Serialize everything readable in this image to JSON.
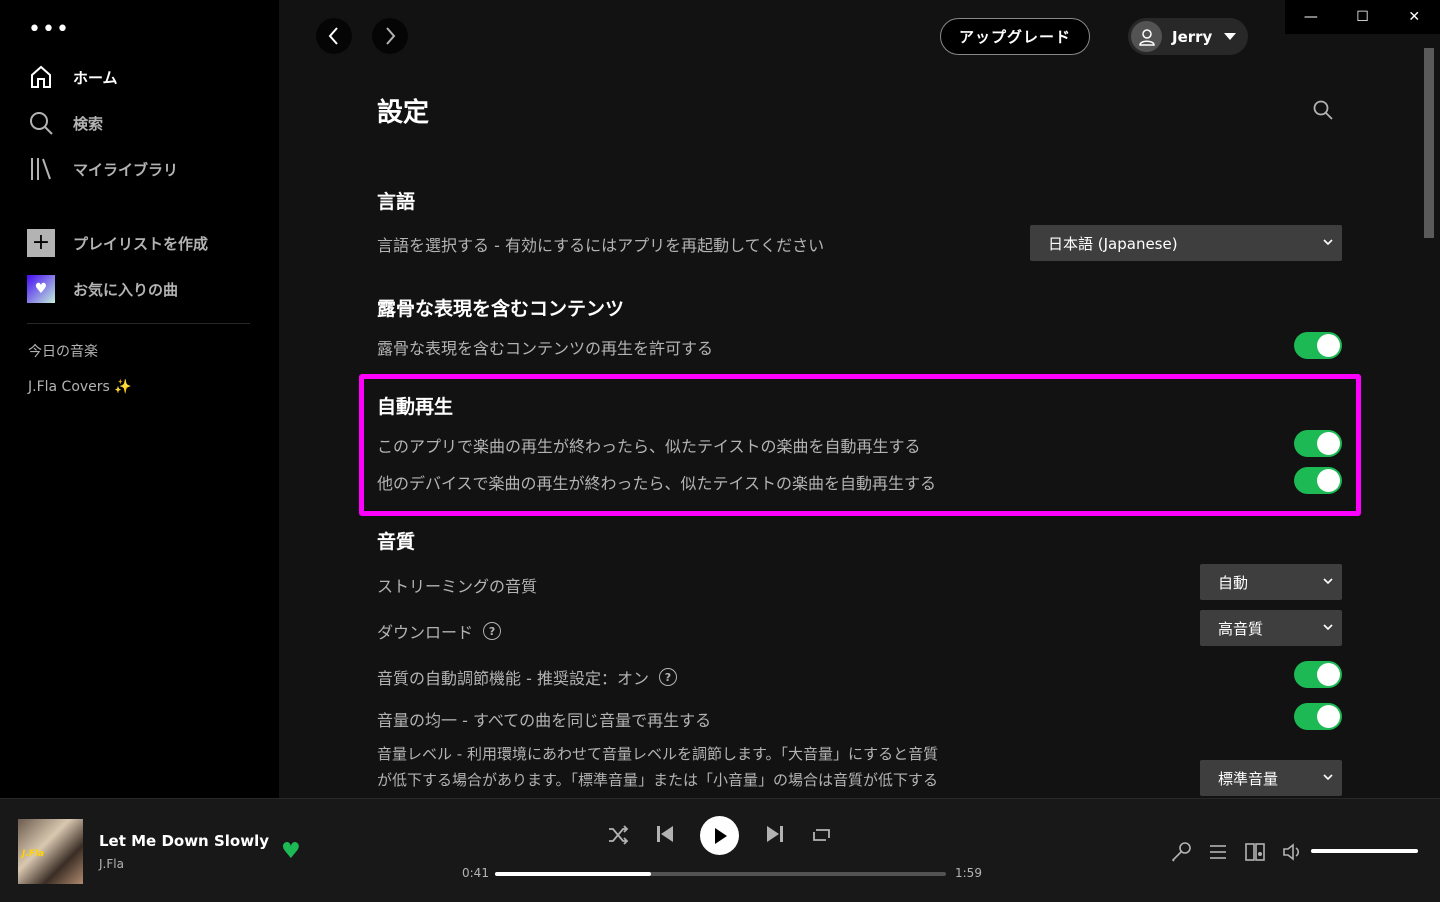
{
  "sidebar": {
    "menu_dots": "•••",
    "nav": [
      {
        "label": "ホーム",
        "icon": "home-icon"
      },
      {
        "label": "検索",
        "icon": "search-icon"
      },
      {
        "label": "マイライブラリ",
        "icon": "library-icon"
      }
    ],
    "actions": [
      {
        "label": "プレイリストを作成",
        "icon": "plus-icon"
      },
      {
        "label": "お気に入りの曲",
        "icon": "heart-icon"
      }
    ],
    "playlists": [
      "今日の音楽",
      "J.Fla Covers ✨"
    ]
  },
  "header": {
    "upgrade_label": "アップグレード",
    "user_name": "Jerry"
  },
  "settings": {
    "title": "設定",
    "language": {
      "heading": "言語",
      "label": "言語を選択する - 有効にするにはアプリを再起動してください",
      "value": "日本語 (Japanese)"
    },
    "explicit": {
      "heading": "露骨な表現を含むコンテンツ",
      "label": "露骨な表現を含むコンテンツの再生を許可する",
      "on": true
    },
    "autoplay": {
      "heading": "自動再生",
      "label1": "このアプリで楽曲の再生が終わったら、似たテイストの楽曲を自動再生する",
      "label2": "他のデバイスで楽曲の再生が終わったら、似たテイストの楽曲を自動再生する",
      "on1": true,
      "on2": true
    },
    "quality": {
      "heading": "音質",
      "streaming_label": "ストリーミングの音質",
      "streaming_value": "自動",
      "download_label": "ダウンロード",
      "download_value": "高音質",
      "auto_adjust_label": "音質の自動調節機能 - 推奨設定：オン",
      "normalize_label": "音量の均一 - すべての曲を同じ音量で再生する",
      "level_line1": "音量レベル - 利用環境にあわせて音量レベルを調節します。「大音量」にすると音質",
      "level_line2": "が低下する場合があります。「標準音量」または「小音量」の場合は音質が低下する",
      "level_value": "標準音量"
    }
  },
  "player": {
    "cover_text": "J.Fla",
    "track": "Let Me Down Slowly",
    "artist": "J.Fla",
    "elapsed": "0:41",
    "duration": "1:59",
    "progress": 0.345,
    "volume": 1.0
  },
  "colors": {
    "accent": "#1db954",
    "highlight": "#ff00ff",
    "background": "#121212"
  }
}
